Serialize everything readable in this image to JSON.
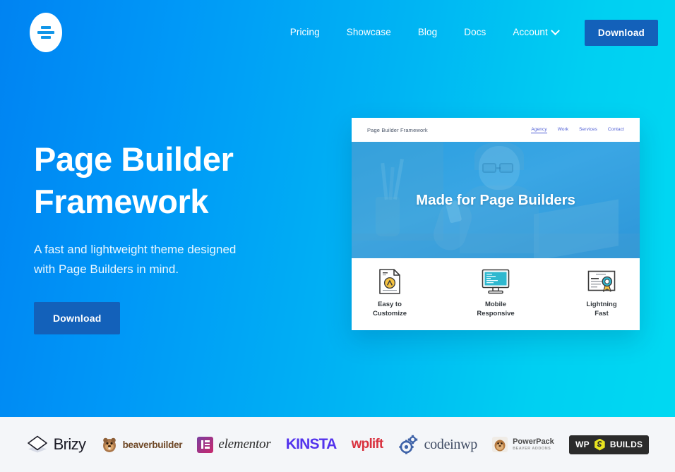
{
  "site": {
    "logo_name": "page-builder-framework-logo"
  },
  "nav": {
    "items": [
      {
        "label": "Pricing"
      },
      {
        "label": "Showcase"
      },
      {
        "label": "Blog"
      },
      {
        "label": "Docs"
      },
      {
        "label": "Account",
        "has_dropdown": true
      }
    ],
    "cta_label": "Download"
  },
  "hero": {
    "title_line1": "Page Builder",
    "title_line2": "Framework",
    "subtitle": "A fast and lightweight theme designed with Page Builders in mind.",
    "cta_label": "Download"
  },
  "mockup": {
    "brand": "Page Builder Framework",
    "nav": [
      {
        "label": "Agency",
        "active": true
      },
      {
        "label": "Work",
        "active": false
      },
      {
        "label": "Services",
        "active": false
      },
      {
        "label": "Contact",
        "active": false
      }
    ],
    "hero_title": "Made for Page Builders",
    "features": [
      {
        "icon": "document-customize-icon",
        "line1": "Easy to",
        "line2": "Customize"
      },
      {
        "icon": "monitor-responsive-icon",
        "line1": "Mobile",
        "line2": "Responsive"
      },
      {
        "icon": "certificate-award-icon",
        "line1": "Lightning",
        "line2": "Fast"
      }
    ]
  },
  "partners": [
    {
      "name": "Brizy",
      "text": "Brizy"
    },
    {
      "name": "Beaver Builder",
      "text": "beaverbuilder"
    },
    {
      "name": "Elementor",
      "text": "elementor"
    },
    {
      "name": "Kinsta",
      "text": "KINSTA"
    },
    {
      "name": "WPLift",
      "text": "wplift"
    },
    {
      "name": "CodeinWP",
      "text": "codeinwp"
    },
    {
      "name": "PowerPack",
      "text": "PowerPack",
      "sub": "BEAVER ADDONS"
    },
    {
      "name": "WP Builds",
      "text_left": "WP",
      "text_right": "BUILDS"
    }
  ],
  "colors": {
    "gradient_start": "#0083f2",
    "gradient_end": "#00d9f2",
    "button": "#1361ba",
    "strip_bg": "#f4f6f9"
  }
}
